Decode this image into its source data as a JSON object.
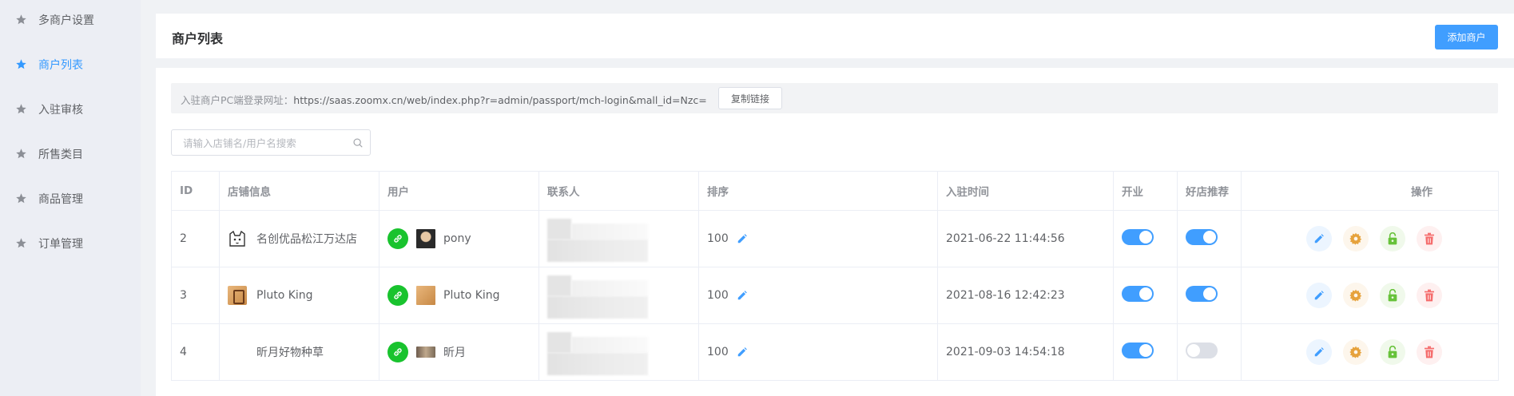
{
  "sidebar": {
    "items": [
      {
        "label": "多商户设置",
        "active": false
      },
      {
        "label": "商户列表",
        "active": true
      },
      {
        "label": "入驻审核",
        "active": false
      },
      {
        "label": "所售类目",
        "active": false
      },
      {
        "label": "商品管理",
        "active": false
      },
      {
        "label": "订单管理",
        "active": false
      }
    ]
  },
  "header": {
    "title": "商户列表",
    "add_button": "添加商户"
  },
  "url_bar": {
    "prefix": "入驻商户PC端登录网址：",
    "url": "https://saas.zoomx.cn/web/index.php?r=admin/passport/mch-login&mall_id=Nzc=",
    "copy_button": "复制链接"
  },
  "search": {
    "placeholder": "请输入店铺名/用户名搜索"
  },
  "table": {
    "columns": [
      "ID",
      "店铺信息",
      "用户",
      "联系人",
      "排序",
      "入驻时间",
      "开业",
      "好店推荐",
      "操作"
    ],
    "rows": [
      {
        "id": "2",
        "store": "名创优品松江万达店",
        "store_logo": "cat-logo",
        "user": "pony",
        "sort": "100",
        "time": "2021-06-22 11:44:56",
        "open": true,
        "recommend": true
      },
      {
        "id": "3",
        "store": "Pluto King",
        "store_logo": "king-logo",
        "user": "Pluto King",
        "sort": "100",
        "time": "2021-08-16 12:42:23",
        "open": true,
        "recommend": true
      },
      {
        "id": "4",
        "store": "昕月好物种草",
        "store_logo": "none",
        "user": "昕月",
        "sort": "100",
        "time": "2021-09-03 14:54:18",
        "open": true,
        "recommend": false
      }
    ]
  },
  "colors": {
    "primary": "#409eff",
    "wechat_green": "#19c32e",
    "edit": "#409eff",
    "settings": "#e6a23c",
    "unlock": "#67c23a",
    "delete": "#f56c6c"
  },
  "icons": {
    "sidebar": "star-icon",
    "search": "search-icon",
    "user_channel": "wechat-link-icon",
    "sort_edit": "pencil-icon",
    "actions": [
      "edit-icon",
      "gear-icon",
      "unlock-icon",
      "trash-icon"
    ]
  }
}
